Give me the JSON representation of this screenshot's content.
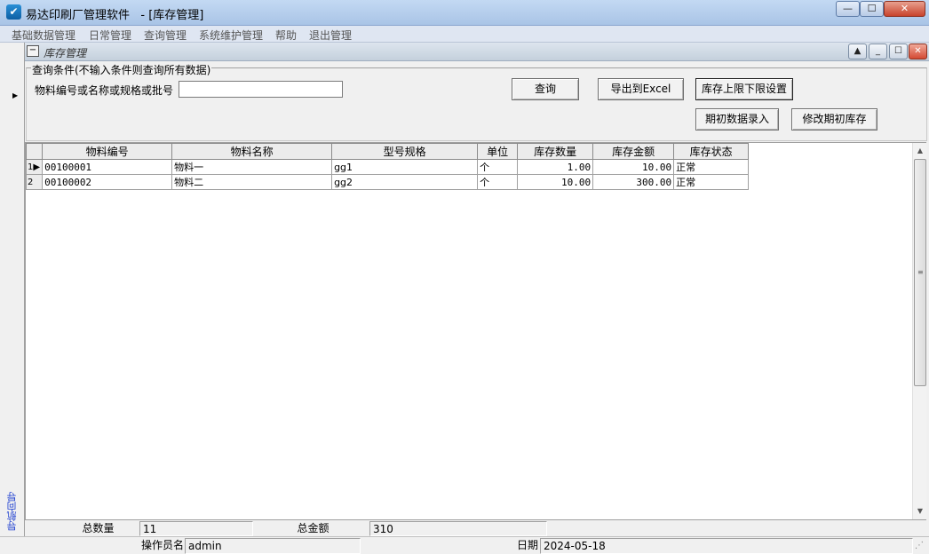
{
  "window": {
    "title": "易达印刷厂管理软件   - [库存管理]",
    "icon": "check-logo-icon"
  },
  "menu": [
    "基础数据管理",
    "日常管理",
    "查询管理",
    "系统维护管理",
    "帮助",
    "退出管理"
  ],
  "navigator": {
    "label": "导航向导"
  },
  "inner_window": {
    "title": "库存管理"
  },
  "query": {
    "caption": "查询条件(不输入条件则查询所有数据)",
    "label": "物料编号或名称或规格或批号",
    "value": "",
    "buttons": {
      "query": "查询",
      "export": "导出到Excel",
      "limits": "库存上限下限设置",
      "initial": "期初数据录入",
      "modify": "修改期初库存"
    }
  },
  "grid": {
    "columns": [
      "物料编号",
      "物料名称",
      "型号规格",
      "单位",
      "库存数量",
      "库存金额",
      "库存状态"
    ],
    "rows": [
      {
        "num": "1",
        "code": "00100001",
        "name": "物料一",
        "spec": "gg1",
        "unit": "个",
        "qty": "1.00",
        "amount": "10.00",
        "status": "正常"
      },
      {
        "num": "2",
        "code": "00100002",
        "name": "物料二",
        "spec": "gg2",
        "unit": "个",
        "qty": "10.00",
        "amount": "300.00",
        "status": "正常"
      }
    ]
  },
  "totals": {
    "qty_label": "总数量",
    "qty_value": "11",
    "amount_label": "总金额",
    "amount_value": "310"
  },
  "status": {
    "operator_label": "操作员名",
    "operator_value": "admin",
    "date_label": "日期",
    "date_value": "2024-05-18"
  }
}
